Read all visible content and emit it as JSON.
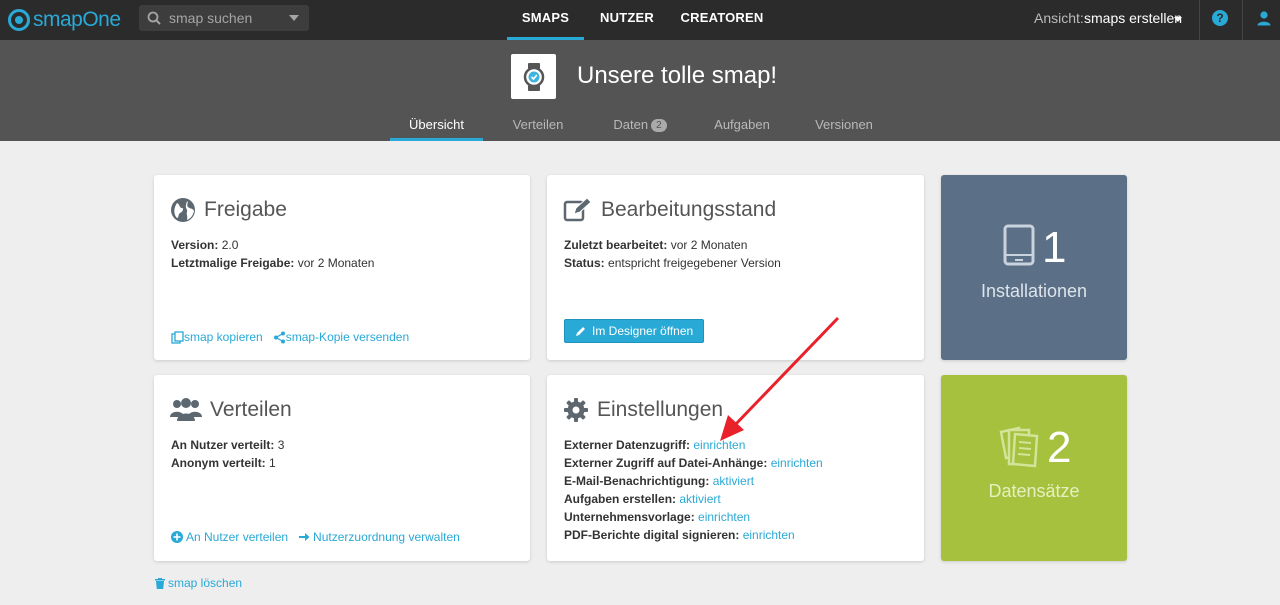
{
  "topbar": {
    "logo": "smapOne",
    "search_placeholder": "smap suchen",
    "nav": [
      "SMAPS",
      "NUTZER",
      "CREATOREN"
    ],
    "view_label": "Ansicht:",
    "view_value": "smaps erstellen",
    "help_glyph": "?"
  },
  "header": {
    "title": "Unsere tolle smap!",
    "tabs": [
      "Übersicht",
      "Verteilen",
      "Daten",
      "Aufgaben",
      "Versionen"
    ],
    "daten_badge": "2"
  },
  "freigabe": {
    "title": "Freigabe",
    "version_key": "Version:",
    "version_val": "2.0",
    "last_key": "Letztmalige Freigabe:",
    "last_val": "vor 2 Monaten",
    "link_copy": "smap kopieren",
    "link_send": "smap-Kopie versenden"
  },
  "bearbeitung": {
    "title": "Bearbeitungsstand",
    "edited_key": "Zuletzt bearbeitet:",
    "edited_val": "vor 2 Monaten",
    "status_key": "Status:",
    "status_val": "entspricht freigegebener Version",
    "button": "Im Designer öffnen"
  },
  "installationen": {
    "count": "1",
    "label": "Installationen",
    "color": "#5b6f86"
  },
  "verteilen": {
    "title": "Verteilen",
    "nutzer_key": "An Nutzer verteilt:",
    "nutzer_val": "3",
    "anonym_key": "Anonym verteilt:",
    "anonym_val": "1",
    "link_nutzer": "An Nutzer verteilen",
    "link_zuordnung": "Nutzerzuordnung verwalten"
  },
  "einstellungen": {
    "title": "Einstellungen",
    "rows": [
      {
        "key": "Externer Datenzugriff:",
        "val": "einrichten"
      },
      {
        "key": "Externer Zugriff auf Datei-Anhänge:",
        "val": "einrichten"
      },
      {
        "key": "E-Mail-Benachrichtigung:",
        "val": "aktiviert"
      },
      {
        "key": "Aufgaben erstellen:",
        "val": "aktiviert"
      },
      {
        "key": "Unternehmensvorlage:",
        "val": "einrichten"
      },
      {
        "key": "PDF-Berichte digital signieren:",
        "val": "einrichten"
      }
    ]
  },
  "datensaetze": {
    "count": "2",
    "label": "Datensätze",
    "color": "#a6c13d"
  },
  "footer": {
    "delete": "smap löschen"
  },
  "colors": {
    "accent": "#29a9d6",
    "annotation_arrow": "#e8212b"
  }
}
